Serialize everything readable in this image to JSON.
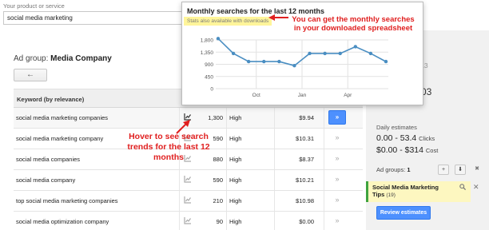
{
  "header": {
    "label": "Your product or service",
    "search_value": "social media marketing"
  },
  "ad_group": {
    "prefix": "Ad group:",
    "name": "Media Company",
    "back_symbol": "←"
  },
  "table": {
    "keyword_header": "Keyword (by relevance)",
    "rows": [
      {
        "keyword": "social media marketing companies",
        "volume": "1,300",
        "competition": "High",
        "cpc": "$9.94",
        "add": "»"
      },
      {
        "keyword": "social media marketing company",
        "volume": "590",
        "competition": "High",
        "cpc": "$10.31",
        "add": "»"
      },
      {
        "keyword": "social media companies",
        "volume": "880",
        "competition": "High",
        "cpc": "$8.37",
        "add": "»"
      },
      {
        "keyword": "social media company",
        "volume": "590",
        "competition": "High",
        "cpc": "$10.21",
        "add": "»"
      },
      {
        "keyword": "top social media marketing companies",
        "volume": "210",
        "competition": "High",
        "cpc": "$10.98",
        "add": "»"
      },
      {
        "keyword": "social media optimization company",
        "volume": "90",
        "competition": "High",
        "cpc": "$0.00",
        "add": "»"
      }
    ]
  },
  "popup": {
    "title": "Monthly searches for the last 12 months",
    "subtitle": "Stats also available with downloads"
  },
  "chart_data": {
    "type": "line",
    "title": "Monthly searches for the last 12 months",
    "y_ticks": [
      "1,800",
      "1,350",
      "900",
      "450",
      "0"
    ],
    "ylim": [
      0,
      1800
    ],
    "x_tick_labels": [
      "Oct",
      "Jan",
      "Apr"
    ],
    "x_tick_positions": [
      3,
      6,
      9
    ],
    "series": [
      {
        "values": [
          1850,
          1300,
          1000,
          1000,
          1000,
          850,
          1300,
          1300,
          1300,
          1550,
          1300,
          1000
        ]
      }
    ],
    "grid": true,
    "line_color": "#4a8ec2"
  },
  "annotations": {
    "downloads_note_line1": "You can get the monthly searches",
    "downloads_note_line2": "in your downloaded spreadsheet",
    "hover_note_line1": "Hover to see search",
    "hover_note_line2": "trends for the last 12",
    "hover_note_line3": "months"
  },
  "right_panel": {
    "date_fragment": ", 2013",
    "digit_fragment": "03",
    "daily_title": "Daily estimates",
    "clicks_value": "0.00 - 53.4",
    "clicks_unit": "Clicks",
    "cost_value": "$0.00 - $314",
    "cost_unit": "Cost",
    "ad_groups_label": "Ad groups:",
    "ad_groups_count": "1",
    "btn_add": "+",
    "btn_download": "⬇",
    "btn_delete": "✖",
    "tip_name": "Social Media Marketing",
    "tip_name2": "Tips",
    "tip_count": "(19)",
    "close_symbol": "✕",
    "review_label": "Review estimates"
  }
}
